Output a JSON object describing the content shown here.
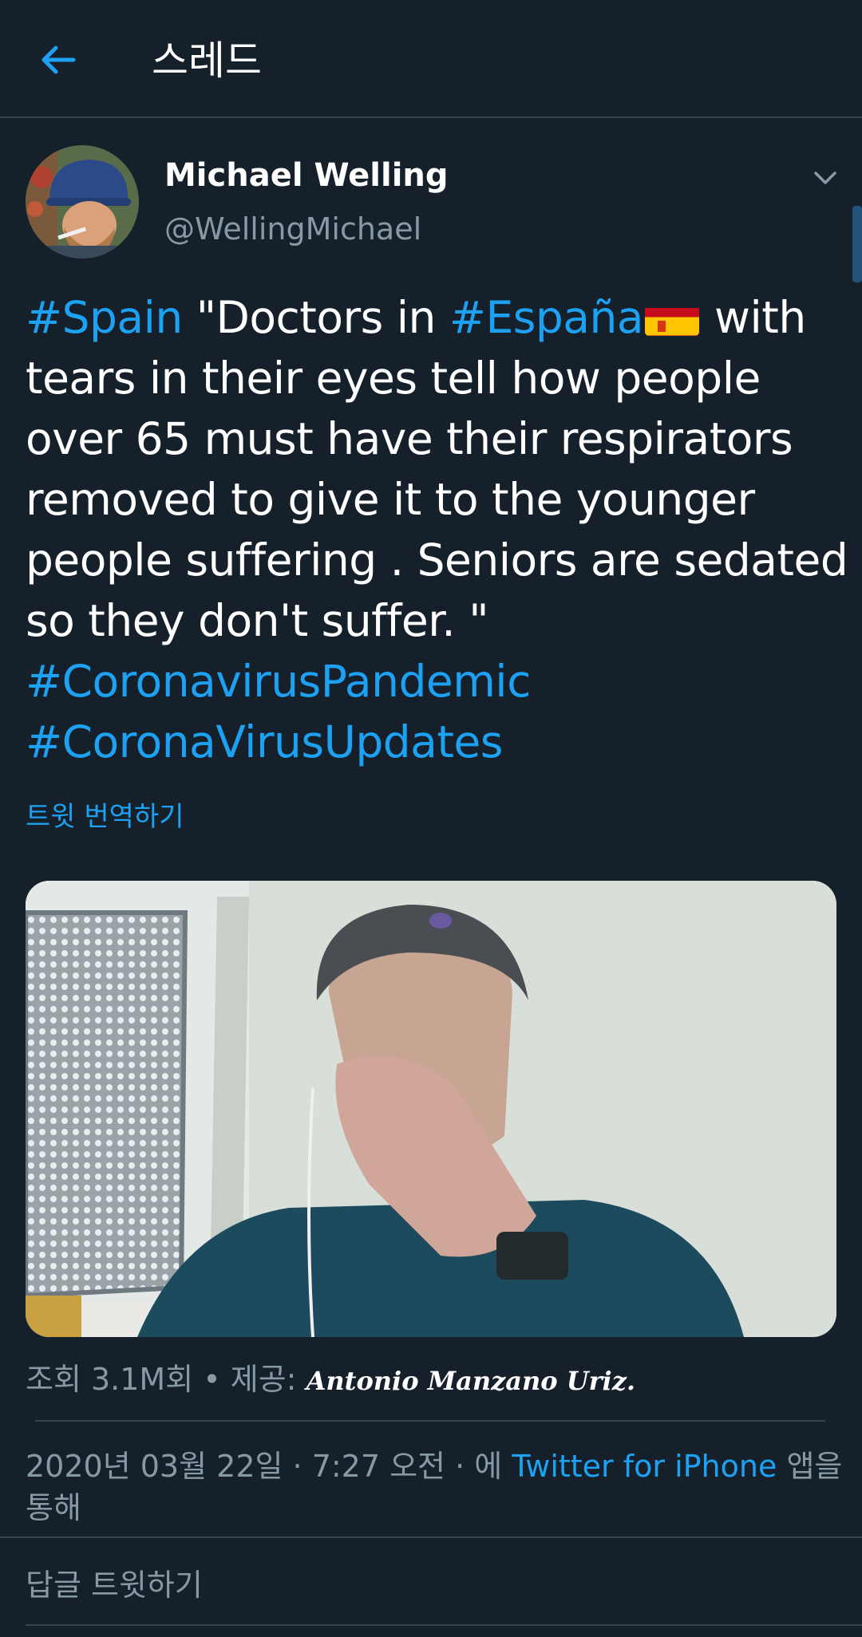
{
  "header": {
    "title": "스레드"
  },
  "tweet": {
    "author_name": "Michael Welling",
    "author_handle": "@WellingMichael",
    "text_parts": {
      "tag_spain": "#Spain",
      "t1": " \"Doctors in ",
      "tag_espana": "#España",
      "t2": " with",
      "line2": "tears in their eyes tell how people",
      "line3": "over 65 must have their respirators",
      "line4": "removed to give it to the younger",
      "line5": "people suffering . Seniors are sedated",
      "line6": "so they don't suffer. \"",
      "tag_pandemic": "#CoronavirusPandemic",
      "tag_updates": "#CoronaVirusUpdates"
    },
    "translate_label": "트윗 번역하기",
    "views_label": "조회 3.1M회 • 제공: ",
    "provider": "Antonio Manzano Uriz.",
    "date": "2020년 03월 22일 · 7:27 오전 · 에 ",
    "source_link": "Twitter for iPhone",
    "source_suffix": " 앱을",
    "source_suffix2": "통해",
    "reply_label": "답글 트윗하기"
  },
  "colors": {
    "background": "#15202b",
    "accent": "#1da1f2",
    "secondary_text": "#8899a6",
    "divider": "#38444d"
  },
  "icons": {
    "back": "arrow-left-icon",
    "menu": "chevron-down-icon",
    "flag": "flag-spain-icon"
  }
}
